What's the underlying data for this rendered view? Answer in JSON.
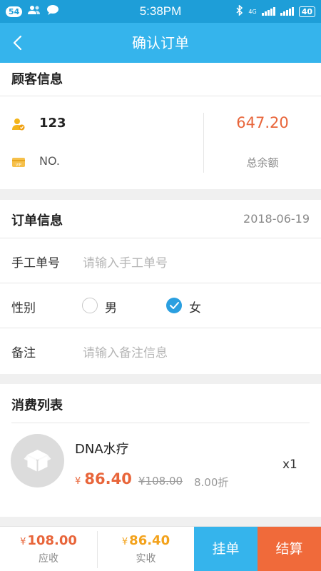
{
  "status_bar": {
    "badge": "54",
    "time": "5:38PM",
    "network": "4G",
    "battery": "40"
  },
  "header": {
    "title": "确认订单"
  },
  "customer": {
    "section_title": "顾客信息",
    "name": "123",
    "card_no": "NO.",
    "balance": "647.20",
    "balance_label": "总余额"
  },
  "order": {
    "section_title": "订单信息",
    "date": "2018-06-19",
    "manual_no_label": "手工单号",
    "manual_no_placeholder": "请输入手工单号",
    "gender_label": "性别",
    "gender_options": [
      {
        "label": "男",
        "selected": false
      },
      {
        "label": "女",
        "selected": true
      }
    ],
    "remark_label": "备注",
    "remark_placeholder": "请输入备注信息"
  },
  "consumption": {
    "section_title": "消费列表",
    "items": [
      {
        "name": "DNA水疗",
        "currency": "¥",
        "price": "86.40",
        "original_price": "¥108.00",
        "discount": "8.00折",
        "quantity": "x1"
      }
    ]
  },
  "footer": {
    "currency": "¥",
    "receivable": "108.00",
    "receivable_label": "应收",
    "received": "86.40",
    "received_label": "实收",
    "hold_button": "挂单",
    "checkout_button": "结算"
  },
  "colors": {
    "status_bar": "#1e9ed8",
    "nav_bar": "#35b4ec",
    "accent_orange": "#e8653a",
    "accent_gold": "#f3a21b",
    "hold_button": "#35b4ec",
    "checkout_button": "#f06a3a",
    "checked_radio": "#2a9fe0"
  }
}
